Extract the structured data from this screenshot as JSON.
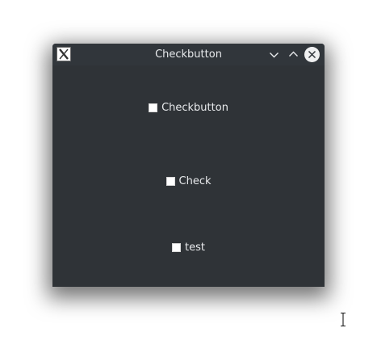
{
  "window": {
    "title": "Checkbutton",
    "icons": {
      "app": "app-x-icon",
      "minimize": "chevron-down-icon",
      "maximize": "chevron-up-icon",
      "close": "close-icon"
    }
  },
  "checkbuttons": [
    {
      "label": "Checkbutton",
      "checked": false
    },
    {
      "label": "Check",
      "checked": false
    },
    {
      "label": "test",
      "checked": false
    }
  ],
  "colors": {
    "window_bg": "#2f3337",
    "titlebar_bg": "#31363b",
    "text": "#e8eaec",
    "checkbox": "#ffffff"
  },
  "pointer": "text-cursor-icon"
}
